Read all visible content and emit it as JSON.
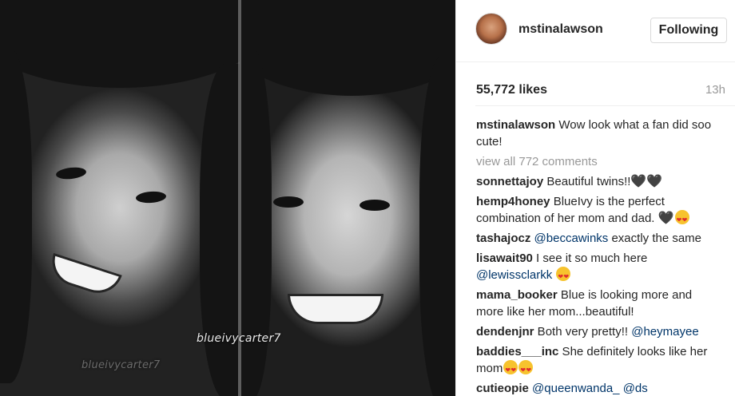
{
  "photo": {
    "watermark_main": "blueivycarter7",
    "watermark_faint": "blueivycarter7"
  },
  "post": {
    "username": "mstinalawson",
    "follow_label": "Following",
    "likes": "55,772 likes",
    "time": "13h",
    "caption_user": "mstinalawson",
    "caption_text": " Wow look what a fan did soo cute!",
    "view_all": "view all 772 comments"
  },
  "comments": [
    {
      "user": "sonnettajoy",
      "text": " Beautiful twins!!",
      "hearts": "🖤🖤"
    },
    {
      "user": "hemp4honey",
      "text": " BlueIvy is the perfect combination of her mom and dad. ",
      "hearts": "🖤"
    },
    {
      "user": "tashajocz",
      "mention": "@beccawinks",
      "text": " exactly the same"
    },
    {
      "user": "lisawait90",
      "text": " I see it so much here ",
      "mention": "@lewissclarkk"
    },
    {
      "user": "mama_booker",
      "text": " Blue is looking more and more like her mom...beautiful!"
    },
    {
      "user": "dendenjnr",
      "text": " Both very pretty!! ",
      "mention": "@heymayee"
    },
    {
      "user": "baddies___inc",
      "text": " She definitely looks like her mom"
    },
    {
      "user": "cutieopie",
      "mention": "@queenwanda_",
      "text": " ",
      "mention2": "@ds"
    }
  ],
  "icons": {
    "avatar": "avatar-photo",
    "emoji": "heart-eyes-emoji"
  }
}
